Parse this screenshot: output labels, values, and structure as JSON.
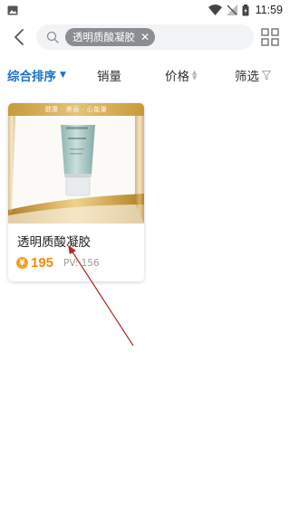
{
  "status_bar": {
    "time": "11:59",
    "icons": [
      "image-icon",
      "wifi-icon",
      "signal-icon",
      "battery-icon"
    ]
  },
  "top_bar": {
    "back_icon": "chevron-left-icon",
    "search_icon": "search-icon",
    "search_chip_text": "透明质酸凝胶",
    "chip_close": "✕",
    "layout_toggle_icon": "grid-icon"
  },
  "sort_tabs": {
    "comprehensive": "综合排序",
    "sales": "销量",
    "price": "价格",
    "filter": "筛选"
  },
  "product": {
    "banner": "健康 · 美丽 · 心能量",
    "title": "透明质酸凝胶",
    "currency_symbol": "¥",
    "price": "195",
    "pv": "PV: 156"
  },
  "colors": {
    "accent": "#1a73c8",
    "price": "#ef8a12",
    "gold": "#c79a3a",
    "annotation": "#b3262a"
  }
}
